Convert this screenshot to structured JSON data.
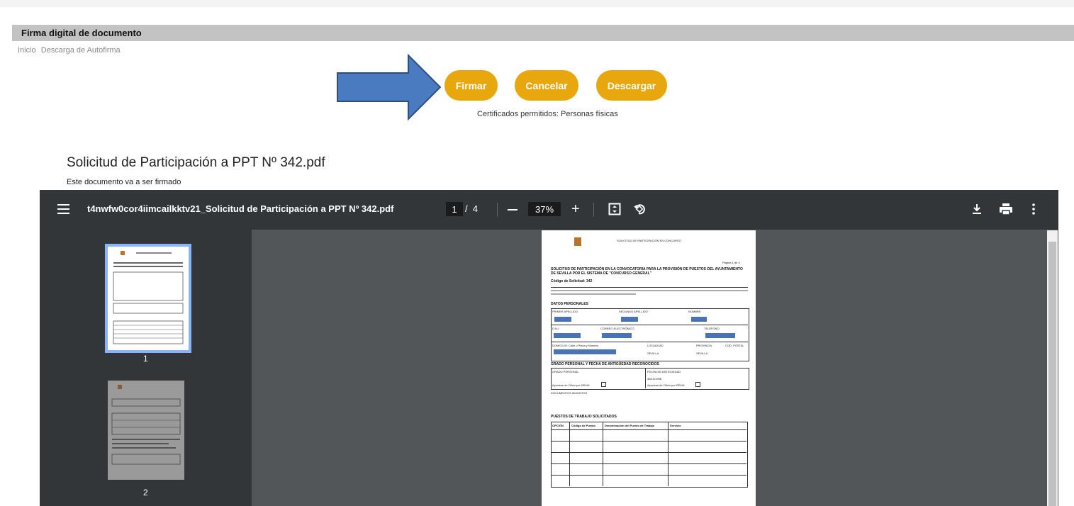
{
  "header": {
    "title": "Firma digital de documento"
  },
  "breadcrumb": [
    "Inicio",
    "Descarga de Autofirma"
  ],
  "actions": {
    "firmar": "Firmar",
    "cancelar": "Cancelar",
    "descargar": "Descargar"
  },
  "certificates_note": "Certificados permitidos: Personas físicas",
  "document": {
    "title": "Solicitud de Participación a PPT Nº 342.pdf",
    "subtitle": "Este documento va a ser firmado"
  },
  "viewer": {
    "filename": "t4nwfw0cor4iimcailkktv21_Solicitud de Participación a PPT Nº 342.pdf",
    "current_page": "1",
    "page_sep": "/",
    "total_pages": "4",
    "zoom": "37%",
    "thumbnails": [
      "1",
      "2"
    ],
    "icons": [
      "menu-icon",
      "zoom-out-icon",
      "zoom-in-icon",
      "fit-page-icon",
      "rotate-icon",
      "download-icon",
      "print-icon",
      "more-icon"
    ]
  },
  "pdf_page": {
    "heading": "SOLICITUD DE PARTICIPACIÓN EN CONCURSO",
    "page_label": "Página 1 de 4",
    "request_title": "SOLICITUD DE PARTICIPACIÓN EN LA CONVOCATORIA PARA LA PROVISIÓN DE PUESTOS DEL AYUNTAMIENTO DE SEVILLA POR EL SISTEMA DE \"CONCURSO GENERAL\"",
    "request_code": "Código de Solicitud: 342",
    "sections": {
      "personal": "DATOS PERSONALES",
      "grado": "GRADO PERSONAL Y FECHA DE ANTIGÜEDAD RECONOCIDOS",
      "puestos": "PUESTOS DE TRABAJO SOLICITADOS"
    },
    "fields": {
      "primer_apellido": "PRIMER APELLIDO",
      "segundo_apellido": "SEGUNDO APELLIDO",
      "nombre": "NOMBRE",
      "dni": "D.N.I.",
      "correo": "CORREO ELECTRÓNICO",
      "telefono": "TELÉFONO",
      "domicilio": "DOMICILIO: Calle o Plaza y Número",
      "localidad": "LOCALIDAD",
      "provincia": "PROVINCIA",
      "cod_postal": "COD. POSTAL",
      "localidad_val": "SEVILLA",
      "provincia_val": "SEVILLA",
      "grado_personal": "GRADO PERSONAL",
      "fecha_antiguedad": "FECHA DE ANTIGÜEDAD",
      "fecha_val": "30/10/1998",
      "aportar_1": "Aportese de Oficio por RRHH",
      "aportar_2": "Aportese de Oficio por RRHH",
      "documentos": "DOCUMENTOS ADJUNTOS"
    },
    "table_headers": [
      "OPCIÓN",
      "Código de Puesto",
      "Denominación del Puesto de Trabajo",
      "Servicio"
    ]
  }
}
